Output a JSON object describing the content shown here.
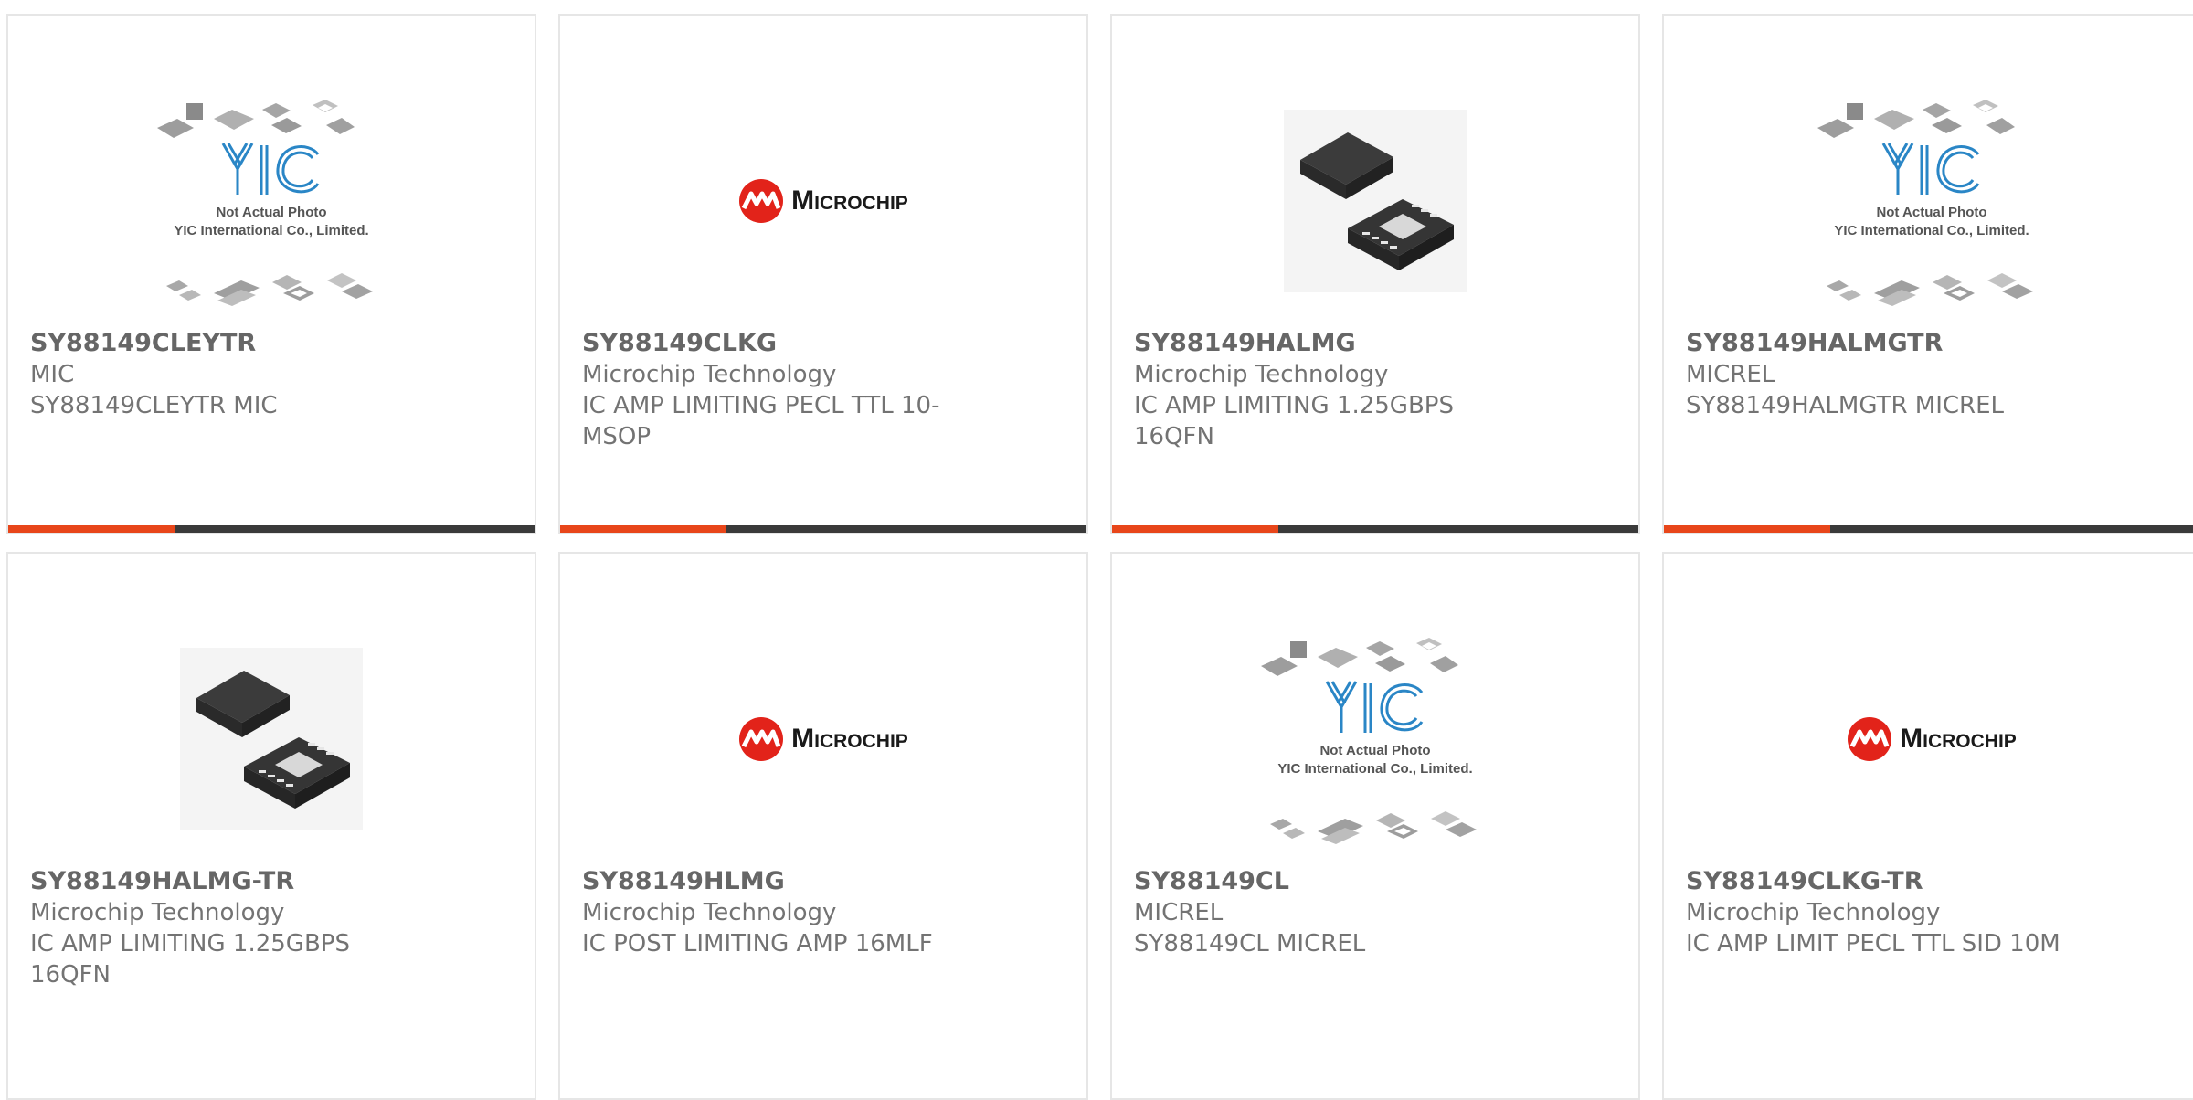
{
  "placeholder_text": {
    "line1": "Not Actual Photo",
    "line2": "YIC International Co., Limited.",
    "logo": "YIC"
  },
  "microchip_logo": {
    "word": "Microchip"
  },
  "colors": {
    "accent": "#e8461a",
    "bar": "#3a3a3a",
    "border": "#e6e6e6"
  },
  "products": [
    {
      "part": "SY88149CLEYTR",
      "manufacturer": "MIC",
      "description": "SY88149CLEYTR MIC",
      "image": "yic-placeholder"
    },
    {
      "part": "SY88149CLKG",
      "manufacturer": "Microchip Technology",
      "description": "IC AMP LIMITING PECL TTL 10-MSOP",
      "image": "microchip-logo"
    },
    {
      "part": "SY88149HALMG",
      "manufacturer": "Microchip Technology",
      "description": "IC AMP LIMITING 1.25GBPS 16QFN",
      "image": "qfn-photo"
    },
    {
      "part": "SY88149HALMGTR",
      "manufacturer": "MICREL",
      "description": "SY88149HALMGTR MICREL",
      "image": "yic-placeholder"
    },
    {
      "part": "SY88149HALMG-TR",
      "manufacturer": "Microchip Technology",
      "description": "IC AMP LIMITING 1.25GBPS 16QFN",
      "image": "qfn-photo"
    },
    {
      "part": "SY88149HLMG",
      "manufacturer": "Microchip Technology",
      "description": "IC POST LIMITING AMP 16MLF",
      "image": "microchip-logo"
    },
    {
      "part": "SY88149CL",
      "manufacturer": "MICREL",
      "description": "SY88149CL MICREL",
      "image": "yic-placeholder"
    },
    {
      "part": "SY88149CLKG-TR",
      "manufacturer": "Microchip Technology",
      "description": "IC AMP LIMIT PECL TTL SID 10M",
      "image": "microchip-logo"
    }
  ]
}
